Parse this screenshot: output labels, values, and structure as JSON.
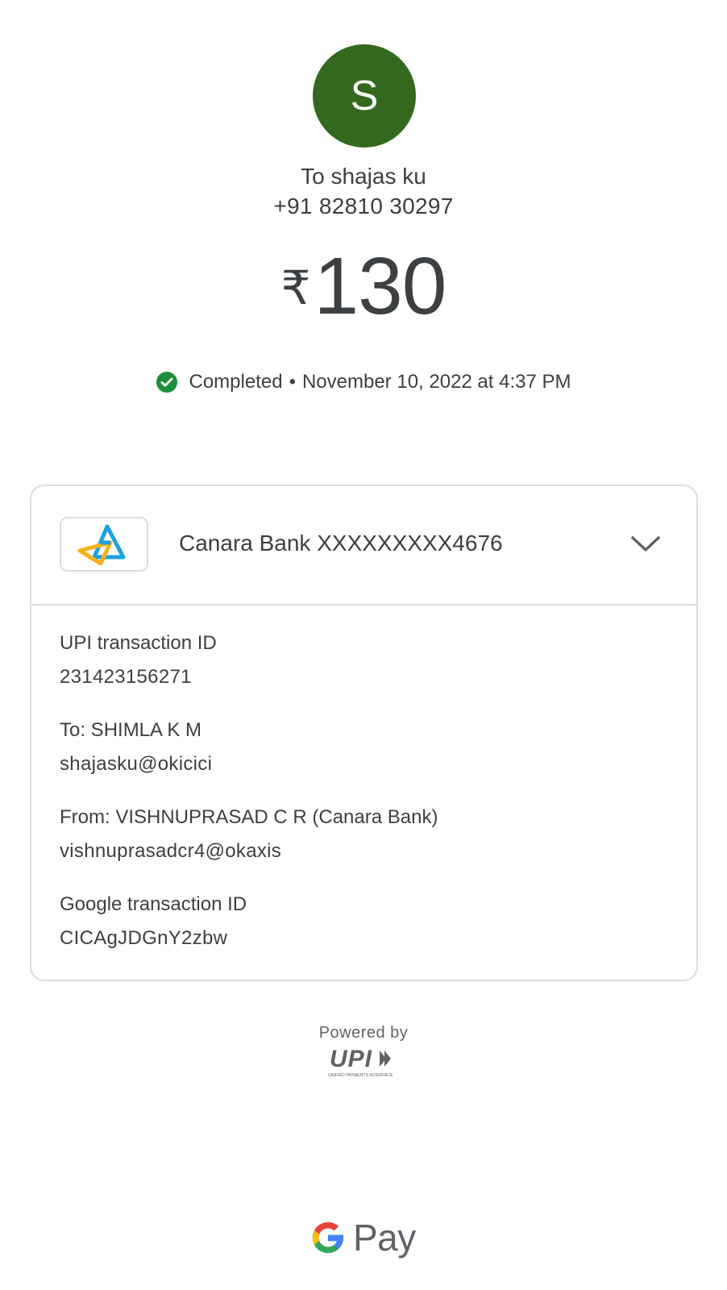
{
  "recipient": {
    "avatar_letter": "S",
    "avatar_color": "#33691e",
    "name": "To shajas ku",
    "phone": "+91 82810 30297"
  },
  "payment": {
    "currency_symbol": "₹",
    "amount": "130",
    "status": "Completed",
    "separator": "•",
    "timestamp": "November 10, 2022 at 4:37 PM",
    "status_icon": "check-circle-icon",
    "status_color": "#1e8e3e"
  },
  "account_card": {
    "bank_label": "Canara Bank XXXXXXXXX4676",
    "bank_logo_icon": "canara-bank-logo",
    "expand_icon": "chevron-down-icon",
    "details": [
      {
        "label": "UPI transaction ID",
        "value": "231423156271"
      },
      {
        "label": "To: SHIMLA K M",
        "value": "shajasku@okicici"
      },
      {
        "label": "From: VISHNUPRASAD C R (Canara Bank)",
        "value": "vishnuprasadcr4@okaxis"
      },
      {
        "label": "Google transaction ID",
        "value": "CICAgJDGnY2zbw"
      }
    ]
  },
  "footer": {
    "powered_by": "Powered by",
    "upi_logo_text": "UPI",
    "upi_tagline": "UNIFIED PAYMENTS INTERFACE",
    "brand_text": "Pay",
    "brand_icon": "google-g-icon"
  }
}
